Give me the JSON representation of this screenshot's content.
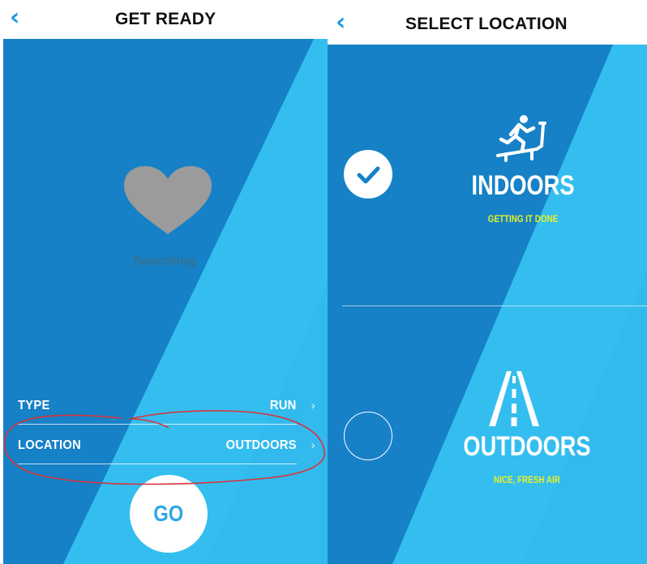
{
  "colors": {
    "primary_blue": "#1681c6",
    "light_blue": "#33bdf0",
    "back_arrow": "#1e9be0",
    "go_text": "#2fa7e4",
    "subtitle_yellow": "#e6ef28",
    "heart_gray": "#9b9b9b",
    "annotation_red": "#d8333b"
  },
  "get_ready": {
    "back_icon": "chevron-left-icon",
    "title": "GET READY",
    "heart_icon": "heart-icon",
    "status": "Searching",
    "type": {
      "label": "TYPE",
      "value": "RUN"
    },
    "location": {
      "label": "LOCATION",
      "value": "OUTDOORS"
    },
    "go_label": "GO"
  },
  "select_location": {
    "back_icon": "chevron-left-icon",
    "title": "SELECT LOCATION",
    "options": [
      {
        "icon": "treadmill-runner-icon",
        "title": "INDOORS",
        "subtitle": "GETTING IT DONE",
        "selected": true
      },
      {
        "icon": "road-icon",
        "title": "OUTDOORS",
        "subtitle": "NICE, FRESH AIR",
        "selected": false
      }
    ]
  }
}
